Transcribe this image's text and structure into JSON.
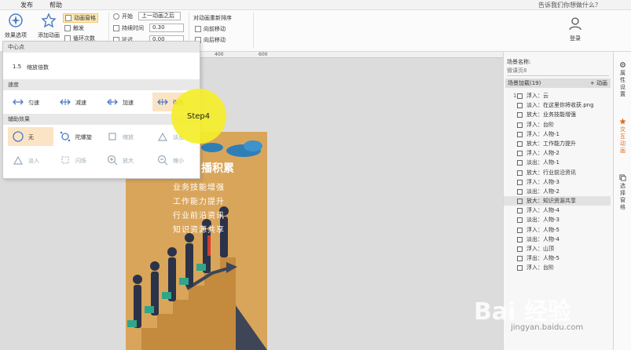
{
  "menubar": {
    "items": [
      "发布",
      "帮助"
    ],
    "tell_me": "告诉我们你想做什么？"
  },
  "ribbon": {
    "effect_options": "效果选项",
    "add_animation": "添加动画",
    "animation_pane": "动画窗格",
    "trigger": "触发",
    "repeat": "循环次数",
    "start_label": "开始",
    "start_value": "上一动画之后",
    "duration_label": "持续时间",
    "duration_value": "0.30",
    "delay_label": "延迟",
    "delay_value": "0.00",
    "reorder_label": "对动画重新排序",
    "move_earlier": "向前移动",
    "move_later": "向后移动",
    "login": "登录"
  },
  "ruler": {
    "ticks": [
      "400",
      "600"
    ]
  },
  "panel": {
    "center_head": "中心点",
    "scale_value": "1.5",
    "scale_label": "缩放倍数",
    "speed_head": "速度",
    "speed_items": [
      "匀速",
      "减速",
      "加速",
      "弹性"
    ],
    "aux_head": "辅助效果",
    "aux_row1": [
      "无",
      "陀螺旋",
      "缩放",
      "淡出"
    ],
    "aux_row2": [
      "淡入",
      "闪烁",
      "放大",
      "缩小"
    ]
  },
  "step_label": "Step4",
  "slide": {
    "title": "播积累",
    "lines": [
      "业务技能增强",
      "工作能力提升",
      "行业前沿资讯",
      "知识资源共享"
    ]
  },
  "scene_panel": {
    "scene_name_label": "场景名称:",
    "scene_name_value": "微课页8",
    "load_head": "场景加载(19)",
    "add_animation": "+ 动画",
    "items": [
      {
        "idx": "1",
        "text": "浮入：云"
      },
      {
        "idx": "",
        "text": "淡入：在这里你将收获.png"
      },
      {
        "idx": "",
        "text": "放大：业务技能增强"
      },
      {
        "idx": "",
        "text": "浮入：台阶"
      },
      {
        "idx": "",
        "text": "浮入：人物-1"
      },
      {
        "idx": "",
        "text": "放大：工作能力提升"
      },
      {
        "idx": "",
        "text": "浮入：人物-2"
      },
      {
        "idx": "",
        "text": "淡出：人物-1"
      },
      {
        "idx": "",
        "text": "放大：行业前沿资讯"
      },
      {
        "idx": "",
        "text": "浮入：人物-3"
      },
      {
        "idx": "",
        "text": "淡出：人物-2"
      },
      {
        "idx": "",
        "text": "放大：知识资源共享"
      },
      {
        "idx": "",
        "text": "浮入：人物-4"
      },
      {
        "idx": "",
        "text": "淡出：人物-3"
      },
      {
        "idx": "",
        "text": "浮入：人物-5"
      },
      {
        "idx": "",
        "text": "淡出：人物-4"
      },
      {
        "idx": "",
        "text": "浮入：山顶"
      },
      {
        "idx": "",
        "text": "浮出：人物-5"
      },
      {
        "idx": "",
        "text": "浮入：台阶"
      }
    ]
  },
  "side_tabs": [
    "属性设置",
    "交互动画",
    "选择窗格"
  ],
  "watermark": {
    "brand": "Bai 经验",
    "url": "jingyan.baidu.com"
  },
  "colors": {
    "accent": "#4a7bc8",
    "highlight": "#f4ee2a",
    "slide_bg": "#d9a55a",
    "active_tab": "#e36c1a"
  }
}
